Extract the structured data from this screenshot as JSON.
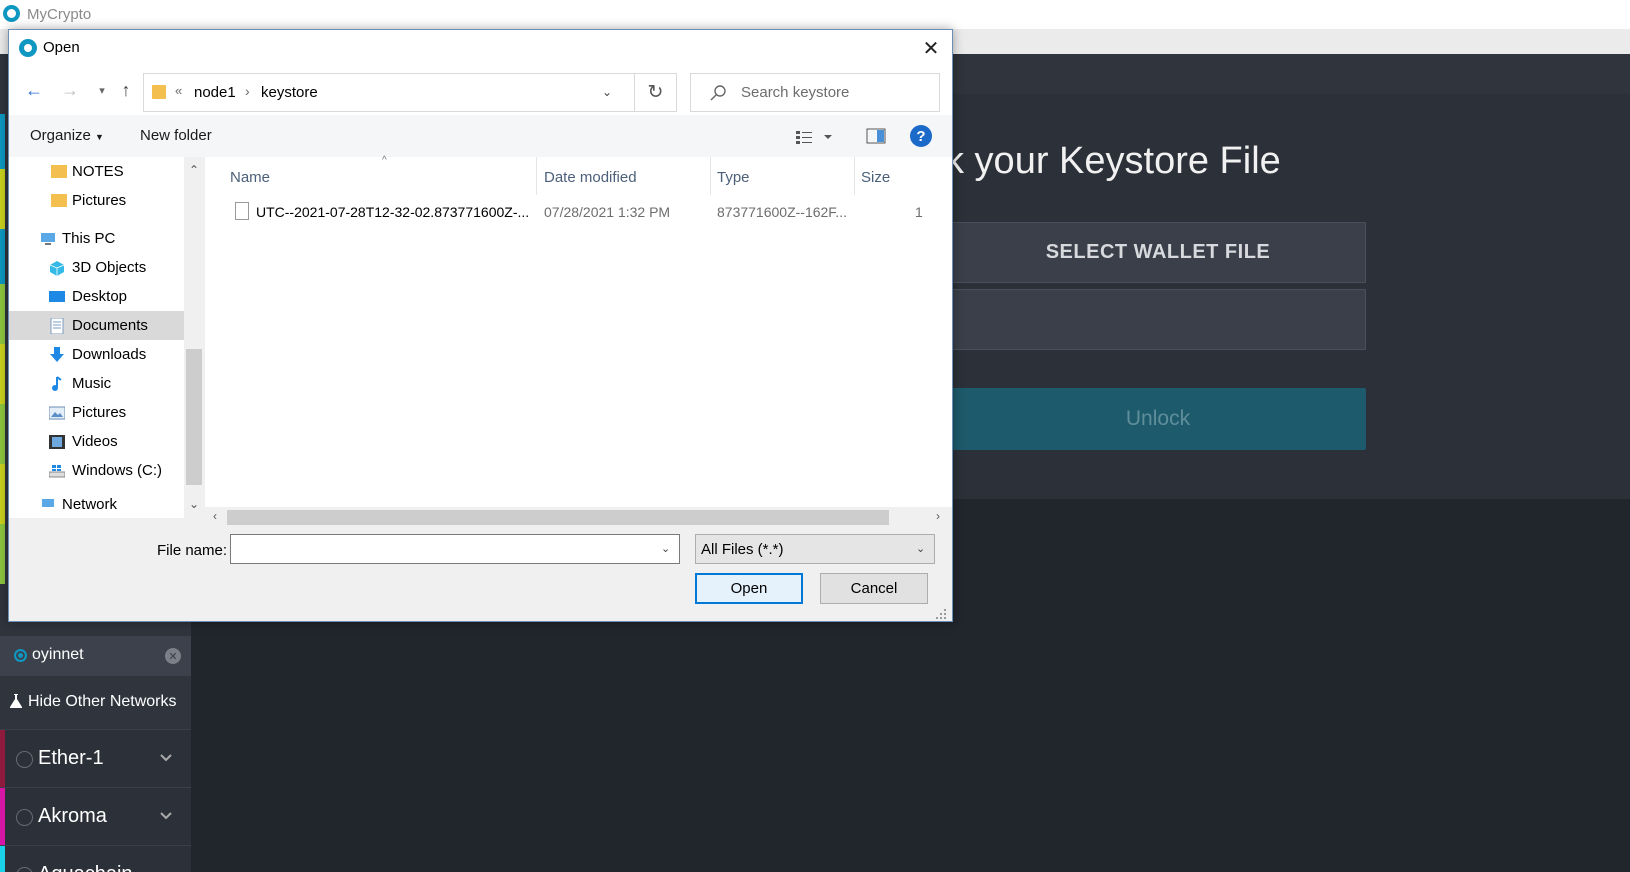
{
  "app": {
    "title": "MyCrypto",
    "heading": "k your Keystore File",
    "select_wallet_label": "SELECT WALLET FILE",
    "unlock_label": "Unlock",
    "colors": {
      "accent": "#0e97c0",
      "unlock_bg": "#1d5a6b",
      "background": "#21252c"
    }
  },
  "sidebar": {
    "custom_network": {
      "label": "oyinnet",
      "selected": true
    },
    "hide_others_label": "Hide Other Networks",
    "networks": [
      {
        "label": "Ether-1",
        "stripe_color": "#8e1a3d"
      },
      {
        "label": "Akroma",
        "stripe_color": "#d816a6"
      },
      {
        "label": "Aquachain",
        "stripe_color": "#1bd3e8"
      }
    ],
    "stripe_colors": [
      "#0e97c0",
      "#c8d11d",
      "#0e97c0",
      "#8cc63f",
      "#c8d11d",
      "#8cc63f",
      "#c8d11d",
      "#8cc63f"
    ]
  },
  "dialog": {
    "title": "Open",
    "path": {
      "parent": "node1",
      "current": "keystore"
    },
    "search_placeholder": "Search keystore",
    "toolbar": {
      "organize": "Organize",
      "new_folder": "New folder",
      "help": "?"
    },
    "nav_items": [
      {
        "label": "NOTES",
        "icon": "folder-icon"
      },
      {
        "label": "Pictures",
        "icon": "folder-icon"
      },
      {
        "label": "This PC",
        "icon": "this-pc-icon"
      },
      {
        "label": "3D Objects",
        "icon": "3d-objects-icon"
      },
      {
        "label": "Desktop",
        "icon": "desktop-icon"
      },
      {
        "label": "Documents",
        "icon": "documents-icon",
        "selected": true
      },
      {
        "label": "Downloads",
        "icon": "downloads-icon"
      },
      {
        "label": "Music",
        "icon": "music-icon"
      },
      {
        "label": "Pictures",
        "icon": "pictures-icon"
      },
      {
        "label": "Videos",
        "icon": "videos-icon"
      },
      {
        "label": "Windows (C:)",
        "icon": "drive-icon"
      },
      {
        "label": "Network",
        "icon": "network-icon"
      }
    ],
    "columns": [
      "Name",
      "Date modified",
      "Type",
      "Size"
    ],
    "files": [
      {
        "name": "UTC--2021-07-28T12-32-02.873771600Z-...",
        "date": "07/28/2021 1:32 PM",
        "type": "873771600Z--162F...",
        "size": "1"
      }
    ],
    "file_name_label": "File name:",
    "file_name_value": "",
    "filter_value": "All Files (*.*)",
    "open_label": "Open",
    "cancel_label": "Cancel"
  }
}
